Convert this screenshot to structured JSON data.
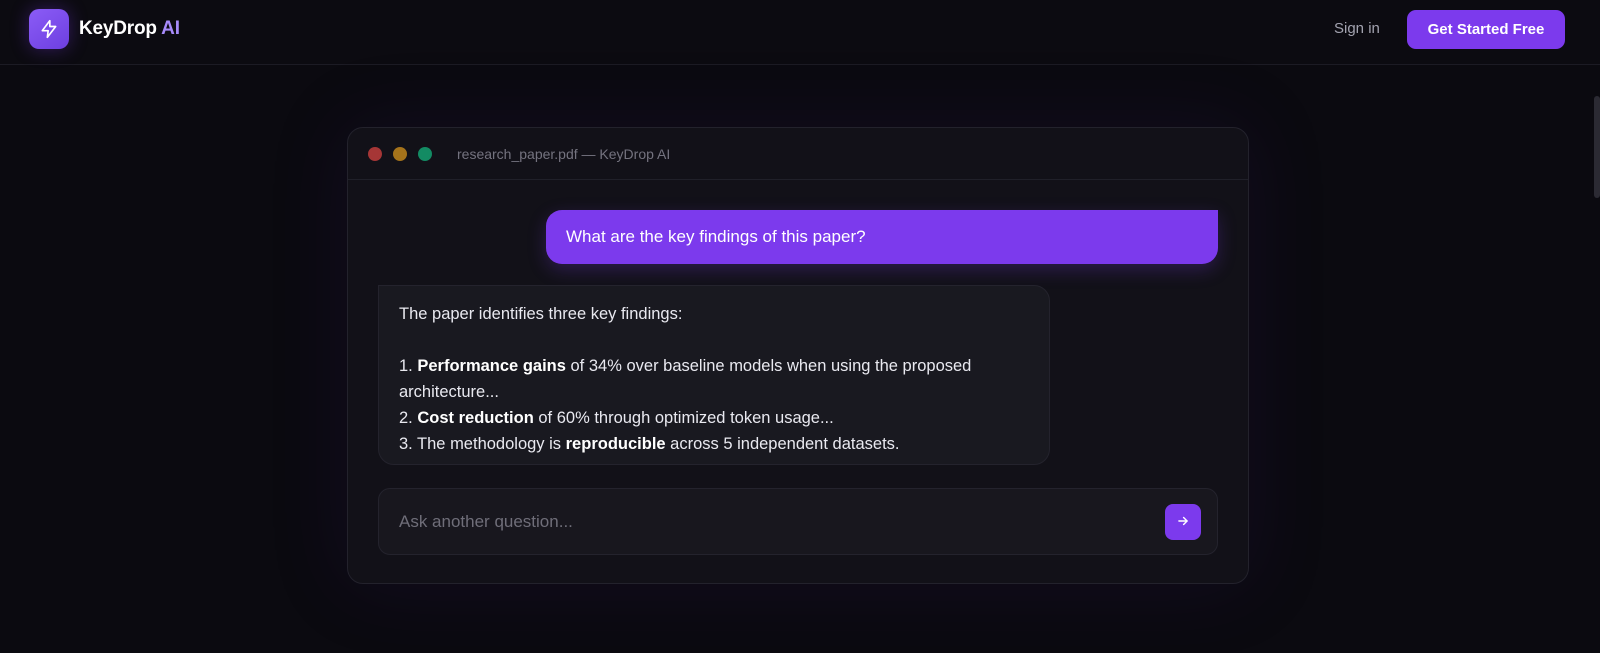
{
  "header": {
    "brand_name": "KeyDrop",
    "brand_accent": "AI",
    "logo_icon": "lightning-bolt-icon",
    "signin_label": "Sign in",
    "cta_label": "Get Started Free"
  },
  "window": {
    "title": "research_paper.pdf — KeyDrop AI",
    "user_message": "What are the key findings of this paper?",
    "assistant": {
      "intro": "The paper identifies three key findings:",
      "items": [
        {
          "prefix": "1. ",
          "bold": "Performance gains",
          "suffix": " of 34% over baseline models when using the proposed architecture..."
        },
        {
          "prefix": "2. ",
          "bold": "Cost reduction",
          "suffix": " of 60% through optimized token usage..."
        },
        {
          "prefix": "3. The methodology is ",
          "bold": "reproducible",
          "suffix": " across 5 independent datasets."
        }
      ]
    },
    "composer": {
      "placeholder": "Ask another question...",
      "send_icon": "arrow-right-icon"
    }
  },
  "colors": {
    "accent": "#7c3aed",
    "accent_light": "#a78bfa",
    "background": "#0b0a10",
    "window_bg": "#121118"
  }
}
